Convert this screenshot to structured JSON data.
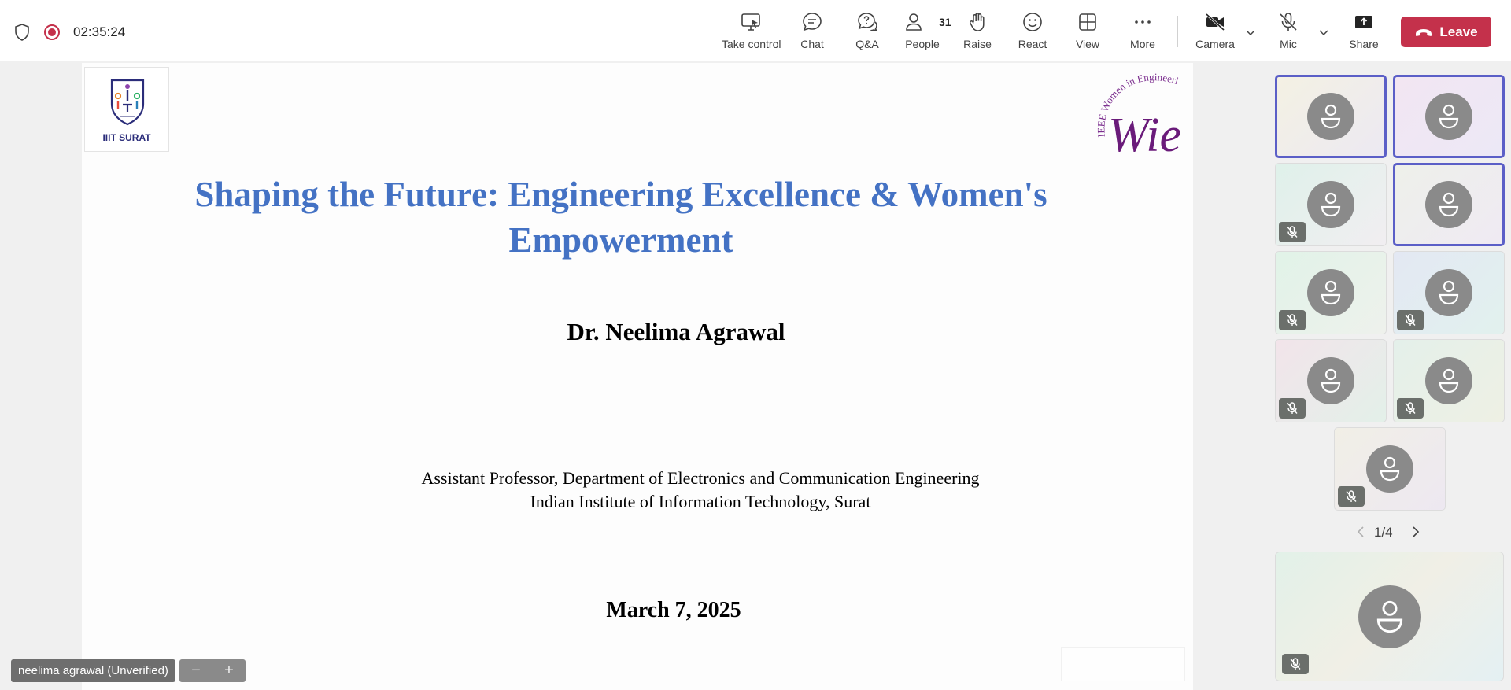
{
  "meeting": {
    "timer": "02:35:24"
  },
  "toolbar": {
    "take_control": "Take control",
    "chat": "Chat",
    "qa": "Q&A",
    "people": "People",
    "people_count": "31",
    "raise": "Raise",
    "react": "React",
    "view": "View",
    "more": "More",
    "camera": "Camera",
    "mic": "Mic",
    "share": "Share",
    "leave": "Leave"
  },
  "slide": {
    "title_line1": "Shaping the Future: Engineering Excellence & Women's",
    "title_line2": "Empowerment",
    "speaker": "Dr. Neelima Agrawal",
    "affiliation_line1": "Assistant Professor, Department of Electronics and Communication Engineering",
    "affiliation_line2": "Indian Institute of Information Technology, Surat",
    "date": "March 7, 2025",
    "logo_left_text": "IIIT SURAT",
    "logo_right_arc_text": "IEEE Women in Engineering",
    "logo_right_text": "Wie"
  },
  "presenter": {
    "name": "neelima agrawal (Unverified)",
    "zoom_out": "−",
    "zoom_in": "+"
  },
  "gallery": {
    "page_indicator": "1/4"
  },
  "colors": {
    "accent": "#5b5fc7",
    "leave": "#c4314b",
    "slide_title": "#4472c4",
    "avatar": "#8a8a8a"
  }
}
